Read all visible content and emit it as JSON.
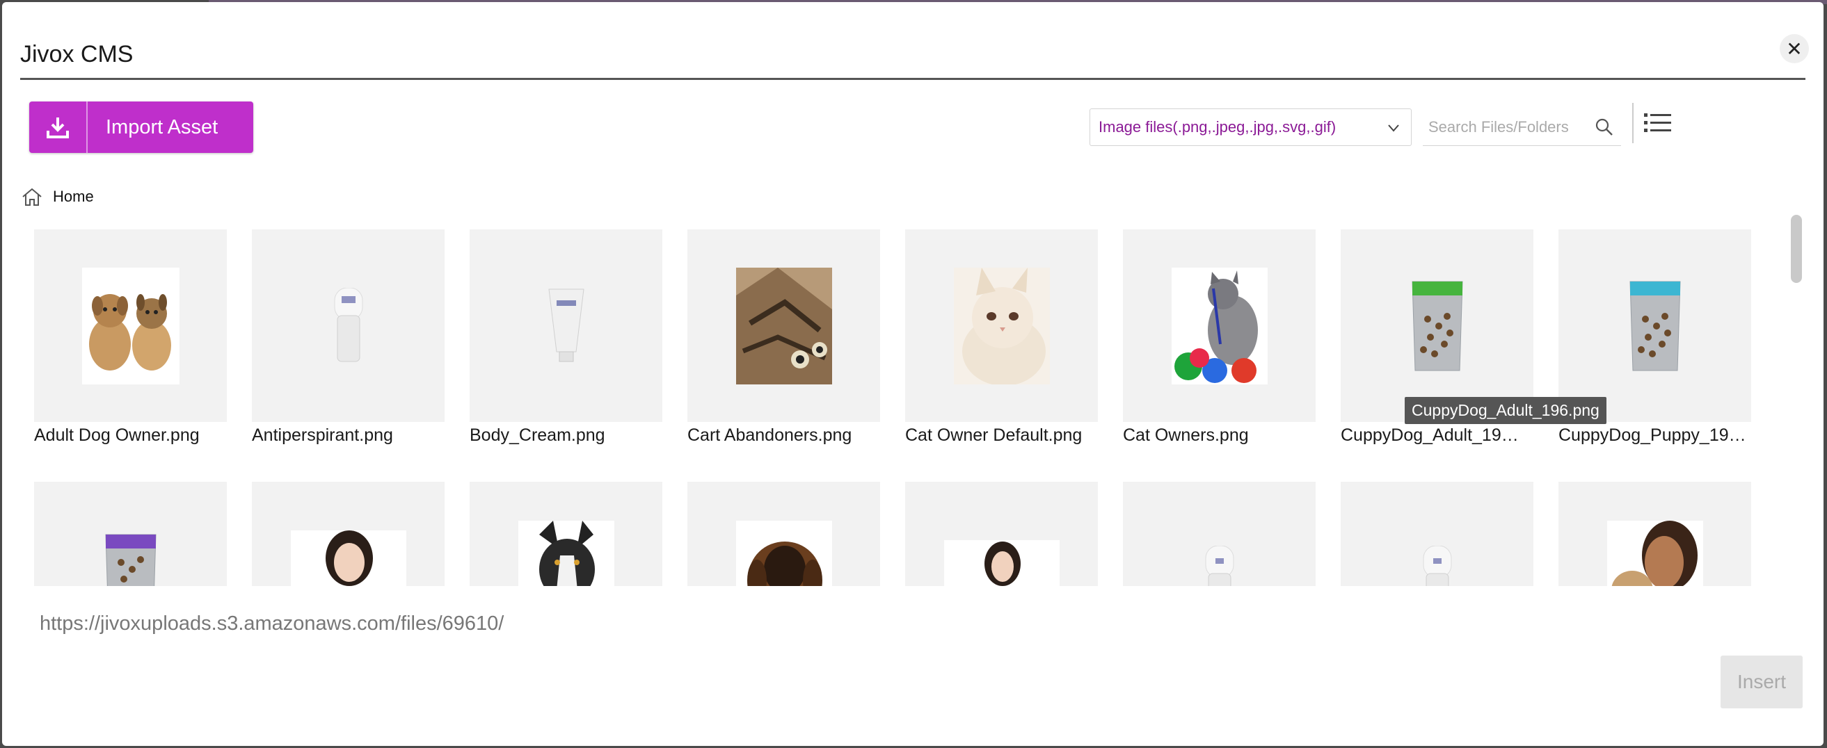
{
  "modal": {
    "title": "Jivox CMS",
    "close_icon": "close-icon"
  },
  "toolbar": {
    "import_label": "Import Asset",
    "import_icon": "download-icon",
    "filter_value": "Image files(.png,.jpeg,.jpg,.svg,.gif)",
    "search_placeholder": "Search Files/Folders",
    "search_icon": "search-icon",
    "view_icon": "list-view-icon"
  },
  "breadcrumb": {
    "home_label": "Home",
    "home_icon": "home-icon"
  },
  "assets": [
    {
      "label": "Adult Dog Owner.png"
    },
    {
      "label": "Antiperspirant.png"
    },
    {
      "label": "Body_Cream.png"
    },
    {
      "label": "Cart Abandoners.png"
    },
    {
      "label": "Cat Owner Default.png"
    },
    {
      "label": "Cat Owners.png"
    },
    {
      "label": "CuppyDog_Adult_19…"
    },
    {
      "label": "CuppyDog_Puppy_19…"
    }
  ],
  "tooltip": "CuppyDog_Adult_196.png",
  "footer": {
    "url": "https://jivoxuploads.s3.amazonaws.com/files/69610/",
    "insert_label": "Insert"
  },
  "colors": {
    "accent": "#bf2fcb",
    "filter_text": "#8b1a96",
    "tile_bg": "#f2f2f2"
  }
}
